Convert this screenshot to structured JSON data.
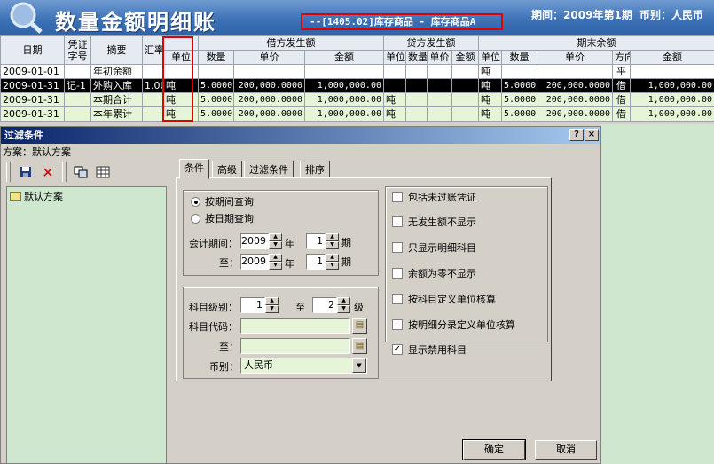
{
  "header": {
    "title": "数量金额明细账",
    "subject": "--[1405.02]库存商品 - 库存商品A",
    "period_label": "期间：2009年第1期",
    "currency_label": "币别：人民币",
    "accent_color": "#3d72b8"
  },
  "table": {
    "group_headers": {
      "debit": "借方发生额",
      "credit": "贷方发生额",
      "ending": "期末余额"
    },
    "columns": {
      "date": "日期",
      "voucher": "凭证字号",
      "summary": "摘要",
      "rate": "汇率",
      "unit": "单位",
      "qty": "数量",
      "price": "单价",
      "amount": "金额",
      "direction": "方向"
    },
    "rows": [
      {
        "date": "2009-01-01",
        "voucher": "",
        "summary": "年初余额",
        "rate": "",
        "unit": "",
        "d_qty": "",
        "d_price": "",
        "d_amt": "",
        "c_unit": "",
        "c_qty": "",
        "c_price": "",
        "c_amt": "",
        "e_unit": "吨",
        "e_qty": "",
        "e_price": "",
        "dir": "平",
        "e_amt": ""
      },
      {
        "date": "2009-01-31",
        "voucher": "记-1",
        "summary": "外购入库",
        "rate": "1.00",
        "unit": "吨",
        "d_qty": "5.0000",
        "d_price": "200,000.0000",
        "d_amt": "1,000,000.00",
        "c_unit": "",
        "c_qty": "",
        "c_price": "",
        "c_amt": "",
        "e_unit": "吨",
        "e_qty": "5.0000",
        "e_price": "200,000.0000",
        "dir": "借",
        "e_amt": "1,000,000.00"
      },
      {
        "date": "2009-01-31",
        "voucher": "",
        "summary": "本期合计",
        "rate": "",
        "unit": "吨",
        "d_qty": "5.0000",
        "d_price": "200,000.0000",
        "d_amt": "1,000,000.00",
        "c_unit": "吨",
        "c_qty": "",
        "c_price": "",
        "c_amt": "",
        "e_unit": "吨",
        "e_qty": "5.0000",
        "e_price": "200,000.0000",
        "dir": "借",
        "e_amt": "1,000,000.00"
      },
      {
        "date": "2009-01-31",
        "voucher": "",
        "summary": "本年累计",
        "rate": "",
        "unit": "吨",
        "d_qty": "5.0000",
        "d_price": "200,000.0000",
        "d_amt": "1,000,000.00",
        "c_unit": "吨",
        "c_qty": "",
        "c_price": "",
        "c_amt": "",
        "e_unit": "吨",
        "e_qty": "5.0000",
        "e_price": "200,000.0000",
        "dir": "借",
        "e_amt": "1,000,000.00"
      }
    ]
  },
  "dialog": {
    "title": "过滤条件",
    "help_btn": "?",
    "close_btn": "×",
    "scheme_label": "方案：默认方案",
    "scheme_tree": [
      "默认方案"
    ],
    "tabs": [
      "条件",
      "高级",
      "过滤条件",
      "排序"
    ],
    "query_by_period": "按期间查询",
    "query_by_date": "按日期查询",
    "period_from_label": "会计期间：",
    "period_to_label": "至：",
    "year_unit": "年",
    "period_unit": "期",
    "from_year": "2009",
    "from_period": "1",
    "to_year": "2009",
    "to_period": "1",
    "level_label": "科目级别：",
    "level_from": "1",
    "level_to_label": "至",
    "level_to": "2",
    "level_unit": "级",
    "code_label": "科目代码：",
    "code_to_label": "至：",
    "code_from": "",
    "code_to": "",
    "currency_field_label": "币别：",
    "currency_value": "人民币",
    "options": [
      {
        "label": "包括未过账凭证",
        "checked": false
      },
      {
        "label": "无发生额不显示",
        "checked": false
      },
      {
        "label": "只显示明细科目",
        "checked": false
      },
      {
        "label": "余额为零不显示",
        "checked": false
      },
      {
        "label": "按科目定义单位核算",
        "checked": false
      },
      {
        "label": "按明细分录定义单位核算",
        "checked": false
      },
      {
        "label": "显示禁用科目",
        "checked": true
      }
    ],
    "ok_label": "确定",
    "cancel_label": "取消"
  }
}
